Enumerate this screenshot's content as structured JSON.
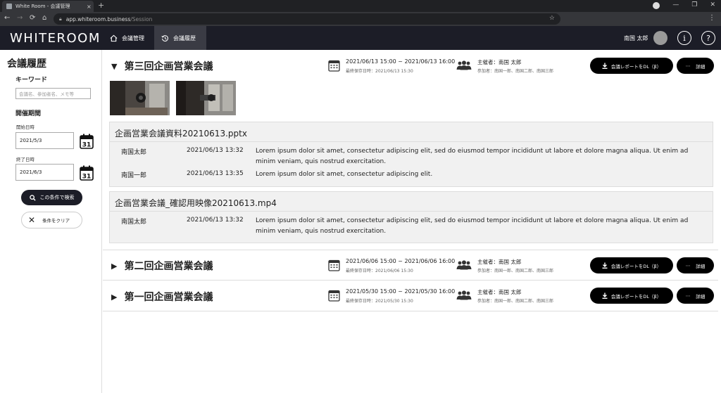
{
  "browser": {
    "tab_title": "White Room - 会議管理",
    "url_host": "app.whiteroom.business",
    "url_path": "/Session",
    "close_tab": "×",
    "new_tab": "+"
  },
  "header": {
    "logo": "WHITEROOM",
    "nav": [
      {
        "label": "会議管理"
      },
      {
        "label": "会議履歴"
      }
    ],
    "user_name": "南国 太郎",
    "info_icon": "i",
    "help_icon": "?"
  },
  "sidebar": {
    "title": "会議履歴",
    "keyword_label": "キーワード",
    "keyword_placeholder": "会議名、参加者名、メモ等",
    "period_label": "開催期間",
    "start_label": "開始日時",
    "start_value": "2021/5/3",
    "end_label": "終了日時",
    "end_value": "2021/6/3",
    "calendar_day": "31",
    "search_button": "この条件で検索",
    "clear_button": "条件をクリア"
  },
  "meetings": [
    {
      "title": "第三回企画営業会議",
      "expanded": true,
      "date": "2021/06/13 15:00 ~ 2021/06/13 16:00",
      "saved": "最終保存日時：2021/06/13 15:30",
      "host": "主催者：南国 太郎",
      "participants": "参加者：南国一郎、南国二郎、南国三郎",
      "download": "会議レポートをDL（β）",
      "detail": "詳細",
      "files": [
        {
          "name": "企画営業会議資料20210613.pptx",
          "comments": [
            {
              "name": "南国太郎",
              "time": "2021/06/13 13:32",
              "text": "Lorem ipsum dolor sit amet, consectetur adipiscing elit, sed do eiusmod tempor incididunt ut labore et dolore magna aliqua. Ut enim ad minim veniam, quis nostrud exercitation."
            },
            {
              "name": "南国一郎",
              "time": "2021/06/13 13:35",
              "text": "Lorem ipsum dolor sit amet, consectetur adipiscing elit."
            }
          ]
        },
        {
          "name": "企画営業会議_確認用映像20210613.mp4",
          "comments": [
            {
              "name": "南国太郎",
              "time": "2021/06/13 13:32",
              "text": "Lorem ipsum dolor sit amet, consectetur adipiscing elit, sed do eiusmod tempor incididunt ut labore et dolore magna aliqua. Ut enim ad minim veniam, quis nostrud exercitation."
            }
          ]
        }
      ]
    },
    {
      "title": "第二回企画営業会議",
      "expanded": false,
      "date": "2021/06/06 15:00 ~ 2021/06/06 16:00",
      "saved": "最終保存日時：2021/06/06 15:30",
      "host": "主催者：南国 太郎",
      "participants": "参加者：南国一郎、南国二郎、南国三郎",
      "download": "会議レポートをDL（β）",
      "detail": "詳細"
    },
    {
      "title": "第一回企画営業会議",
      "expanded": false,
      "date": "2021/05/30 15:00 ~ 2021/05/30 16:00",
      "saved": "最終保存日時：2021/05/30 15:30",
      "host": "主催者：南国 太郎",
      "participants": "参加者：南国一郎、南国二郎、南国三郎",
      "download": "会議レポートをDL（β）",
      "detail": "詳細"
    }
  ],
  "colors": {
    "header_bg": "#1c1d27",
    "button_bg": "#000000",
    "file_panel_bg": "#f1f1f1"
  }
}
